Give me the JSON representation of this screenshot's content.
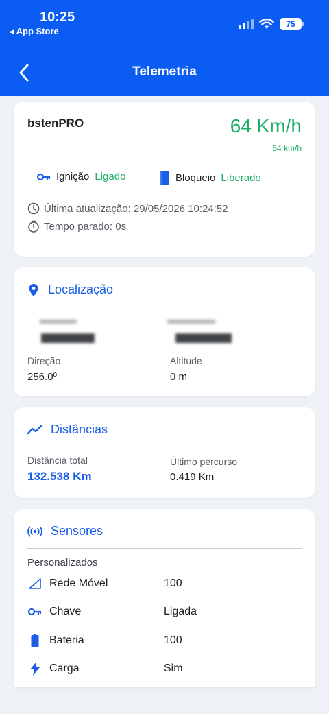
{
  "status_bar": {
    "time": "10:25",
    "back_app": "◂ App Store",
    "battery": "75"
  },
  "header": {
    "title": "Telemetria"
  },
  "vehicle": {
    "name": "bstenPRO",
    "speed": "64 Km/h",
    "speed_small": "64 km/h",
    "ignition_label": "Ignição",
    "ignition_value": "Ligado",
    "block_label": "Bloqueio",
    "block_value": "Liberado",
    "last_update": "Última atualização: 29/05/2026 10:24:52",
    "stopped_time": "Tempo parado: 0s"
  },
  "location": {
    "title": "Localização",
    "direction_label": "Direção",
    "direction_value": "256.0º",
    "altitude_label": "Altitude",
    "altitude_value": "0 m"
  },
  "distances": {
    "title": "Distâncias",
    "total_label": "Distância total",
    "total_value": "132.538 Km",
    "last_label": "Último percurso",
    "last_value": "0.419 Km"
  },
  "sensors": {
    "title": "Sensores",
    "section_label": "Personalizados",
    "items": [
      {
        "name": "Rede Móvel",
        "value": "100",
        "icon": "signal-icon"
      },
      {
        "name": "Chave",
        "value": "Ligada",
        "icon": "key-icon"
      },
      {
        "name": "Bateria",
        "value": "100",
        "icon": "battery-icon"
      },
      {
        "name": "Carga",
        "value": "Sim",
        "icon": "bolt-icon"
      }
    ]
  },
  "colors": {
    "primary": "#0b5cf2",
    "accent_blue": "#1a5ee8",
    "green": "#1fae6a"
  }
}
